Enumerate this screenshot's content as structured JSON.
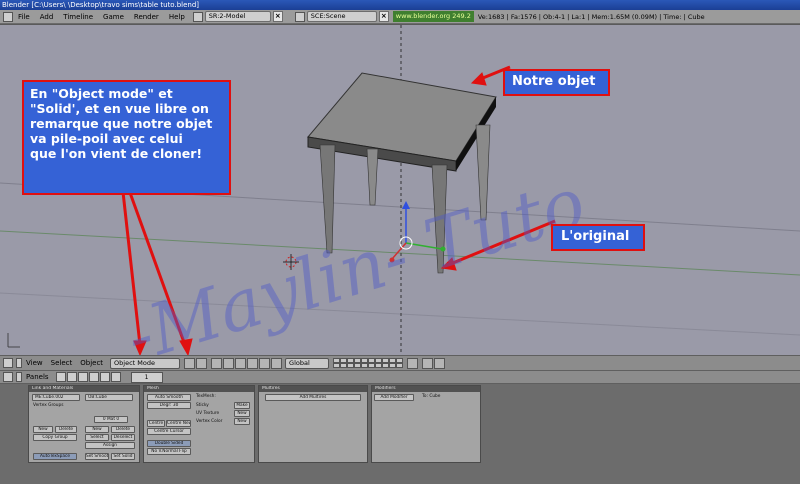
{
  "window": {
    "title": "Blender [C:\\Users\\         \\Desktop\\travo sims\\table tuto.blend]"
  },
  "topbar": {
    "menus": [
      "File",
      "Add",
      "Timeline",
      "Game",
      "Render",
      "Help"
    ],
    "screen": "SR:2-Model",
    "scene": "SCE:Scene",
    "url": "www.blender.org 249.2",
    "stats": "Ve:1683 | Fa:1576 | Ob:4-1 | La:1  | Mem:1.65M (0.09M)  | Time: | Cube"
  },
  "annotations": {
    "main": [
      "En  \"Object mode\" et",
      "\"Solid', et en vue libre on",
      "remarque que notre objet",
      "va pile-poil avec celui",
      "que l'on vient de cloner!"
    ],
    "object": "Notre objet",
    "original": "L'original",
    "watermark": "-Maylin- Tuto"
  },
  "view3d_header": {
    "menus": [
      "View",
      "Select",
      "Object"
    ],
    "mode": "Object Mode",
    "orientation": "Global"
  },
  "buttons_header": {
    "panels_label": "Panels",
    "frame": "1"
  },
  "buttons": {
    "link_panel": {
      "title": "Link and Materials",
      "me": "ME:Cube.002",
      "ob": "OB:Cube",
      "vertex_groups": "Vertex Groups",
      "mat": "0 Mat 0",
      "new": "New",
      "delete": "Delete",
      "copy_group": "Copy Group",
      "new2": "New",
      "delete2": "Delete",
      "select": "Select",
      "deselect": "Deselect",
      "assign": "Assign",
      "autotexspace": "AutoTexSpace",
      "set_smooth": "Set Smooth",
      "set_solid": "Set Solid"
    },
    "mesh_panel": {
      "title": "Mesh",
      "auto_smooth": "Auto Smooth",
      "degr": "Degr: 30",
      "centre": "Centre",
      "centre_new": "Centre New",
      "centre_cursor": "Centre Cursor",
      "double_sided": "Double Sided",
      "no_vnormal_flip": "No V.Normal Flip",
      "tex_mesh": "TexMesh:",
      "sticky": "Sticky",
      "uv_texture": "UV Texture",
      "vertex_color": "Vertex Color",
      "make": "Make",
      "new": "New",
      "new2": "New"
    },
    "multires_panel": {
      "title": "Multires",
      "add": "Add Multires"
    },
    "modifiers_panel": {
      "title": "Modifiers",
      "add": "Add Modifier",
      "to": "To: Cube"
    }
  },
  "colors": {
    "viewport_bg": "#9a9aa8",
    "note_bg": "#3562d6",
    "note_border": "#e01010",
    "arrow": "#e01010"
  }
}
